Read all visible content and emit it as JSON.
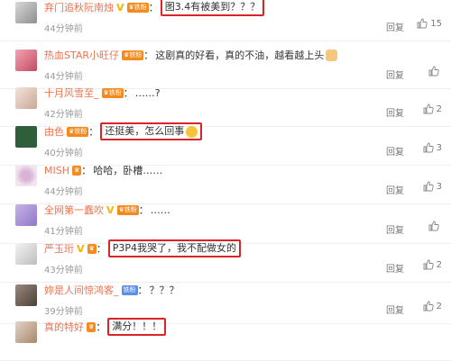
{
  "reply_label": "回复",
  "comments": [
    {
      "name": "弃门追秋阮南烛",
      "content": "图3.4有被美到？？？",
      "time": "44分钟前",
      "likes": "15",
      "highlighted": true
    },
    {
      "name": "热血STAR小旺仔",
      "content": "这剧真的好看，真的不油，越看越上头",
      "time": "44分钟前",
      "likes": "",
      "highlighted": false
    },
    {
      "name": "十月风雪至_",
      "content": "……?",
      "time": "42分钟前",
      "likes": "2",
      "highlighted": false
    },
    {
      "name": "由色",
      "content": "还挺美，怎么回事",
      "time": "40分钟前",
      "likes": "3",
      "highlighted": true
    },
    {
      "name": "MISH",
      "content": "哈哈，卧槽……",
      "time": "44分钟前",
      "likes": "3",
      "highlighted": false
    },
    {
      "name": "全网第一蠢吹",
      "content": "……",
      "time": "41分钟前",
      "likes": "",
      "highlighted": false
    },
    {
      "name": "严玉珩",
      "content": "P3P4我哭了，我不配做女的",
      "time": "43分钟前",
      "likes": "2",
      "highlighted": true
    },
    {
      "name": "妳是人间惊鸿客_",
      "content": "？？？",
      "time": "39分钟前",
      "likes": "2",
      "highlighted": false
    },
    {
      "name": "真的特好",
      "content": "满分！！！",
      "time": "",
      "likes": "",
      "highlighted": true
    }
  ]
}
